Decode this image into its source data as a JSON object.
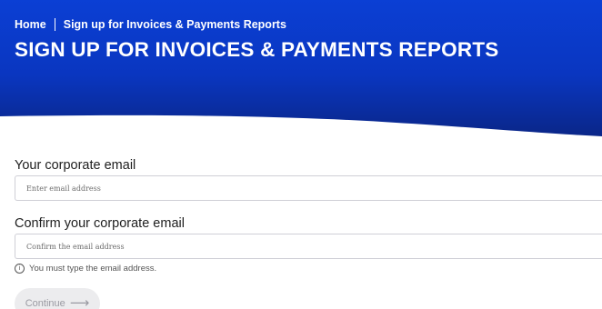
{
  "breadcrumb": {
    "home": "Home",
    "current": "Sign up for Invoices & Payments Reports"
  },
  "hero": {
    "title": "SIGN UP FOR INVOICES & PAYMENTS REPORTS",
    "color_top": "#0b3fd4",
    "color_bottom": "#0a2a8f"
  },
  "form": {
    "email_label": "Your corporate email",
    "email_placeholder": "Enter email address",
    "confirm_label": "Confirm your corporate email",
    "confirm_placeholder": "Confirm the email address",
    "hint_icon": "info-icon",
    "hint_text": "You must type the email address.",
    "continue_label": "Continue",
    "continue_icon": "arrow-right-icon"
  }
}
